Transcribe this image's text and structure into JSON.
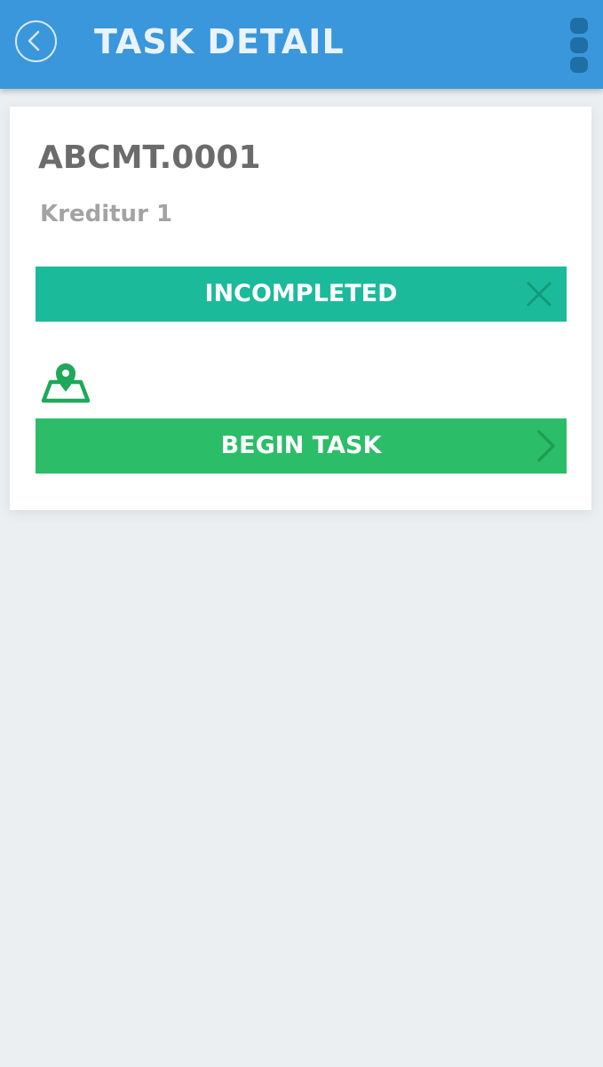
{
  "app_bar": {
    "title": "TASK DETAIL",
    "back_icon": "chevron-left-circle-icon",
    "menu_icon": "more-vertical-icon",
    "background_color": "#3a97dc"
  },
  "task": {
    "code": "ABCMT.0001",
    "subtitle": "Kreditur 1",
    "status": {
      "label": "INCOMPLETED",
      "icon": "close-icon",
      "color": "#1bba9a"
    },
    "location_icon": "map-pin-icon",
    "begin_button": {
      "label": "BEGIN TASK",
      "icon": "chevron-right-icon",
      "color": "#2bbd68"
    }
  },
  "colors": {
    "page_background": "#ebeff1",
    "card_background": "#ffffff",
    "map_icon": "#1ea85a"
  }
}
